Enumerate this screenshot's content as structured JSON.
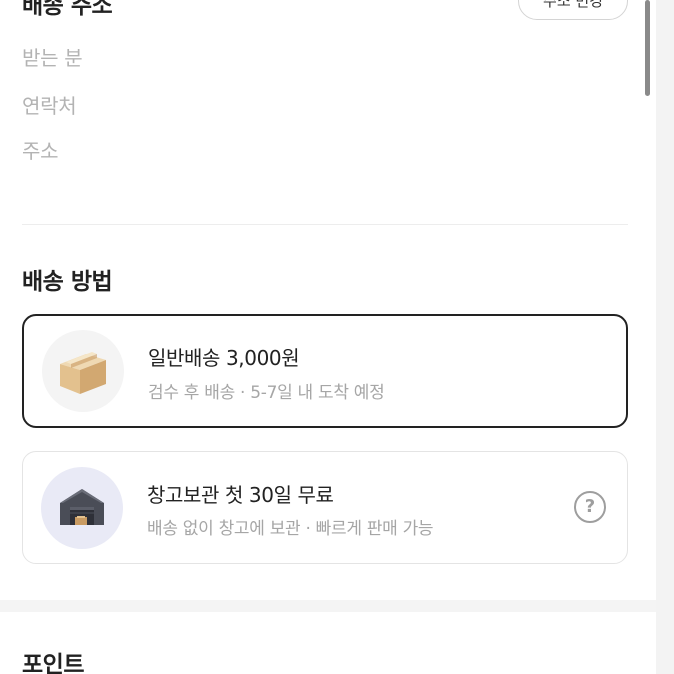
{
  "address": {
    "title": "배송 주소",
    "change_button": "주소 변경",
    "labels": [
      "받는 분",
      "연락처",
      "주소"
    ]
  },
  "shipping_method": {
    "title": "배송 방법",
    "options": [
      {
        "title": "일반배송 3,000원",
        "subtitle": "검수 후 배송 · 5-7일 내 도착 예정",
        "icon": "box-icon",
        "selected": true
      },
      {
        "title": "창고보관 첫 30일 무료",
        "subtitle": "배송 없이 창고에 보관 · 빠르게 판매 가능",
        "icon": "warehouse-icon",
        "help_icon": "?",
        "selected": false
      }
    ]
  },
  "points": {
    "title": "포인트"
  },
  "colors": {
    "selected_border": "#222222",
    "card_border": "#e4e4e4",
    "muted_text": "#a6a6a6",
    "warehouse_bg": "#e9eaf6"
  }
}
